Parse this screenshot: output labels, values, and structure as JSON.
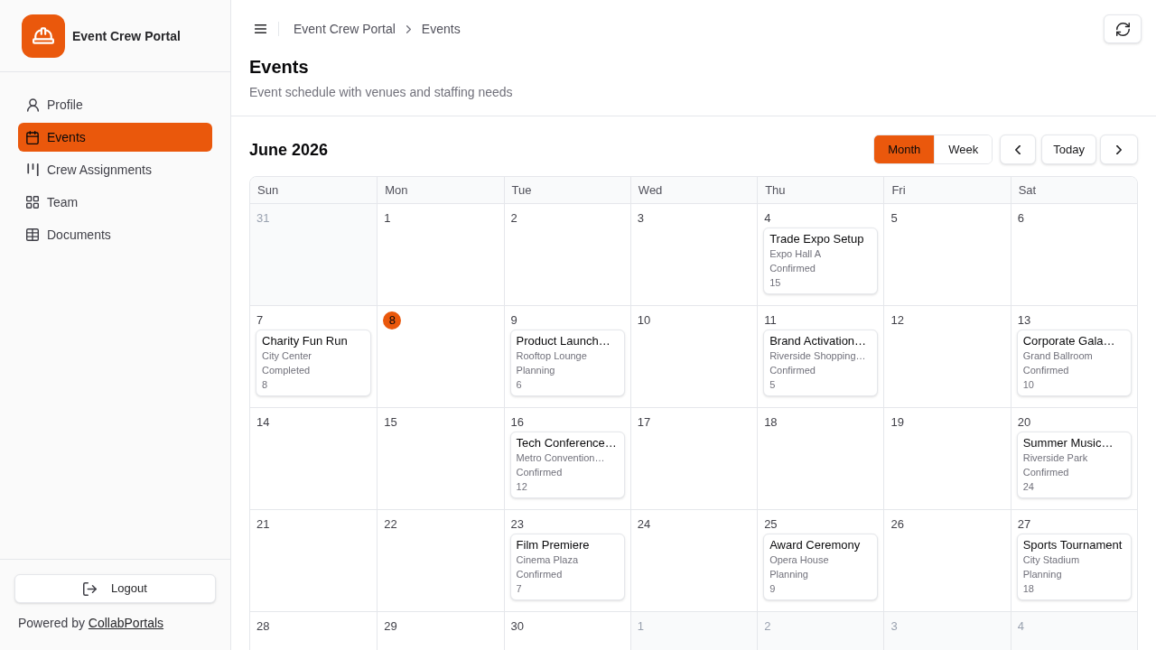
{
  "sidebar": {
    "app_name": "Event Crew Portal",
    "nav_items": [
      {
        "label": "Profile",
        "selected": false
      },
      {
        "label": "Events",
        "selected": true
      },
      {
        "label": "Crew Assignments",
        "selected": false
      },
      {
        "label": "Team",
        "selected": false
      },
      {
        "label": "Documents",
        "selected": false
      }
    ],
    "logout_button": "Logout",
    "footer": {
      "text": "Powered by",
      "link": "CollabPortals"
    }
  },
  "header": {
    "breadcrumbs": [
      "Event Crew Portal",
      "Events"
    ]
  },
  "page": {
    "title": "Events",
    "subtitle": "Event schedule with venues and staffing needs"
  },
  "calendar": {
    "month_label": "June 2026",
    "view_tabs": [
      {
        "label": "Month",
        "selected": true
      },
      {
        "label": "Week",
        "selected": false
      }
    ],
    "today_button": "Today",
    "weekdays": [
      "Sun",
      "Mon",
      "Tue",
      "Wed",
      "Thu",
      "Fri",
      "Sat"
    ],
    "weeks": [
      [
        {
          "date": "31",
          "in_month": false,
          "today": false
        },
        {
          "date": "1",
          "in_month": true,
          "today": false
        },
        {
          "date": "2",
          "in_month": true,
          "today": false
        },
        {
          "date": "3",
          "in_month": true,
          "today": false
        },
        {
          "date": "4",
          "in_month": true,
          "today": false,
          "events": [
            {
              "title": "Trade Expo Setup",
              "venue": "Expo Hall A",
              "status": "Confirmed",
              "crew_count": "15"
            }
          ]
        },
        {
          "date": "5",
          "in_month": true,
          "today": false
        },
        {
          "date": "6",
          "in_month": true,
          "today": false
        }
      ],
      [
        {
          "date": "7",
          "in_month": true,
          "today": false,
          "events": [
            {
              "title": "Charity Fun Run",
              "venue": "City Center",
              "status": "Completed",
              "crew_count": "8"
            }
          ]
        },
        {
          "date": "8",
          "in_month": true,
          "today": true
        },
        {
          "date": "9",
          "in_month": true,
          "today": false,
          "events": [
            {
              "title": "Product Launch…",
              "venue": "Rooftop Lounge",
              "status": "Planning",
              "crew_count": "6"
            }
          ]
        },
        {
          "date": "10",
          "in_month": true,
          "today": false
        },
        {
          "date": "11",
          "in_month": true,
          "today": false,
          "events": [
            {
              "title": "Brand Activation…",
              "venue": "Riverside Shopping…",
              "status": "Confirmed",
              "crew_count": "5"
            }
          ]
        },
        {
          "date": "12",
          "in_month": true,
          "today": false
        },
        {
          "date": "13",
          "in_month": true,
          "today": false,
          "events": [
            {
              "title": "Corporate Gala…",
              "venue": "Grand Ballroom",
              "status": "Confirmed",
              "crew_count": "10"
            }
          ]
        }
      ],
      [
        {
          "date": "14",
          "in_month": true,
          "today": false
        },
        {
          "date": "15",
          "in_month": true,
          "today": false
        },
        {
          "date": "16",
          "in_month": true,
          "today": false,
          "events": [
            {
              "title": "Tech Conference…",
              "venue": "Metro Convention…",
              "status": "Confirmed",
              "crew_count": "12"
            }
          ]
        },
        {
          "date": "17",
          "in_month": true,
          "today": false
        },
        {
          "date": "18",
          "in_month": true,
          "today": false
        },
        {
          "date": "19",
          "in_month": true,
          "today": false
        },
        {
          "date": "20",
          "in_month": true,
          "today": false,
          "events": [
            {
              "title": "Summer Music…",
              "venue": "Riverside Park",
              "status": "Confirmed",
              "crew_count": "24"
            }
          ]
        }
      ],
      [
        {
          "date": "21",
          "in_month": true,
          "today": false
        },
        {
          "date": "22",
          "in_month": true,
          "today": false
        },
        {
          "date": "23",
          "in_month": true,
          "today": false,
          "events": [
            {
              "title": "Film Premiere",
              "venue": "Cinema Plaza",
              "status": "Confirmed",
              "crew_count": "7"
            }
          ]
        },
        {
          "date": "24",
          "in_month": true,
          "today": false
        },
        {
          "date": "25",
          "in_month": true,
          "today": false,
          "events": [
            {
              "title": "Award Ceremony",
              "venue": "Opera House",
              "status": "Planning",
              "crew_count": "9"
            }
          ]
        },
        {
          "date": "26",
          "in_month": true,
          "today": false
        },
        {
          "date": "27",
          "in_month": true,
          "today": false,
          "events": [
            {
              "title": "Sports Tournament",
              "venue": "City Stadium",
              "status": "Planning",
              "crew_count": "18"
            }
          ]
        }
      ],
      [
        {
          "date": "28",
          "in_month": true,
          "today": false
        },
        {
          "date": "29",
          "in_month": true,
          "today": false
        },
        {
          "date": "30",
          "in_month": true,
          "today": false
        },
        {
          "date": "1",
          "in_month": false,
          "today": false
        },
        {
          "date": "2",
          "in_month": false,
          "today": false
        },
        {
          "date": "3",
          "in_month": false,
          "today": false
        },
        {
          "date": "4",
          "in_month": false,
          "today": false
        }
      ]
    ]
  }
}
